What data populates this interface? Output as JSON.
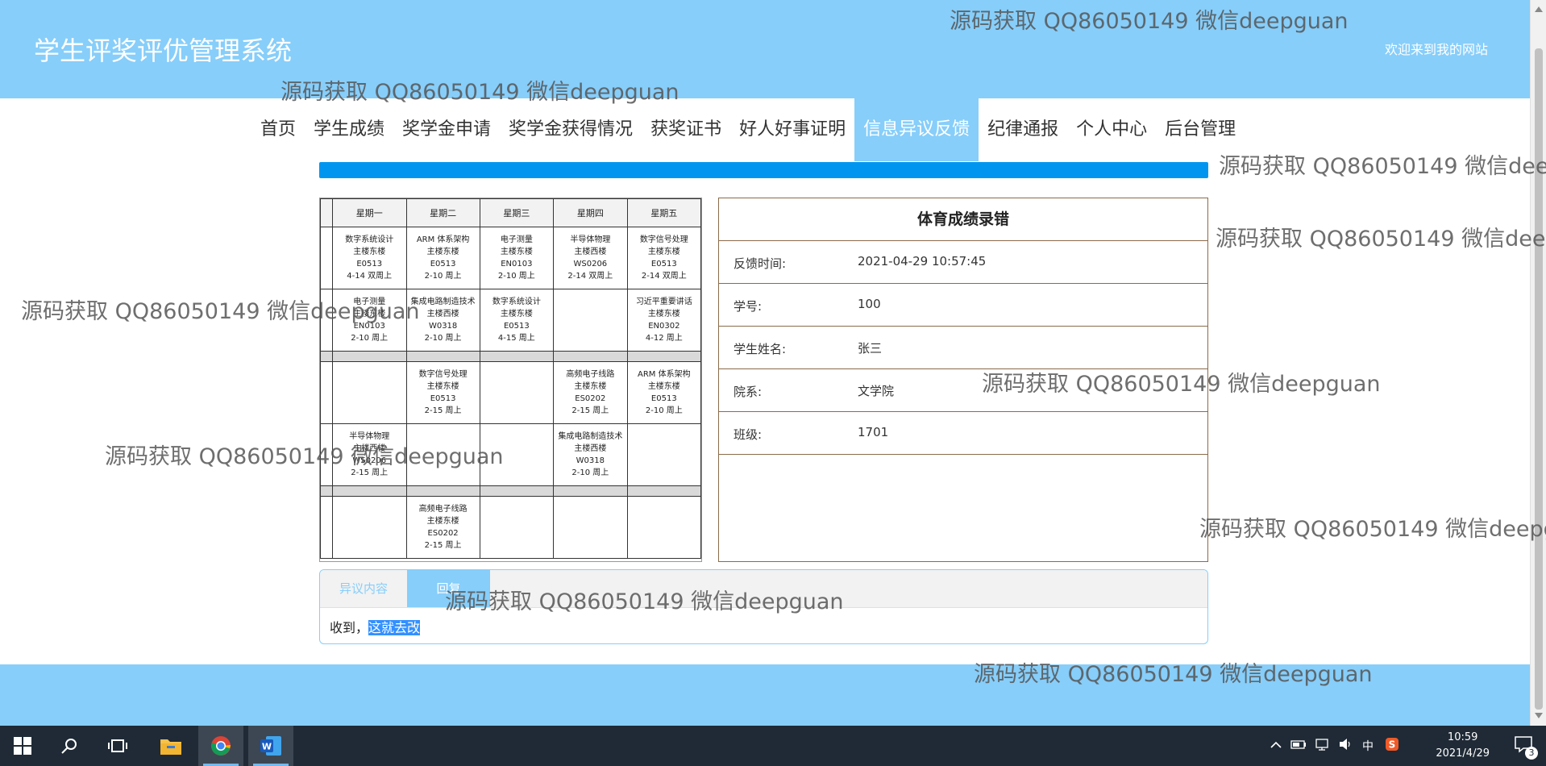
{
  "header": {
    "title": "学生评奖评优管理系统",
    "welcome": "欢迎来到我的网站"
  },
  "nav": {
    "items": [
      "首页",
      "学生成绩",
      "奖学金申请",
      "奖学金获得情况",
      "获奖证书",
      "好人好事证明",
      "信息异议反馈",
      "纪律通报",
      "个人中心",
      "后台管理"
    ],
    "active": "信息异议反馈"
  },
  "schedule": {
    "headers": [
      "",
      "星期一",
      "星期二",
      "星期三",
      "星期四",
      "星期五"
    ],
    "rows": [
      [
        "",
        "数字系统设计\n主楼东楼\nE0513\n4-14 双周上",
        "ARM 体系架构\n主楼东楼\nE0513\n2-10 周上",
        "电子测量\n主楼东楼\nEN0103\n2-10 周上",
        "半导体物理\n主楼西楼\nWS0206\n2-14 双周上",
        "数字信号处理\n主楼东楼\nE0513\n2-14 双周上"
      ],
      [
        "",
        "电子测量\n主楼东楼\nEN0103\n2-10 周上",
        "集成电路制造技术\n主楼西楼\nW0318\n2-10 周上",
        "数字系统设计\n主楼东楼\nE0513\n4-15 周上",
        "",
        "习近平重要讲话\n主楼东楼\nEN0302\n4-12 周上"
      ],
      [
        "",
        "",
        "数字信号处理\n主楼东楼\nE0513\n2-15 周上",
        "",
        "高频电子线路\n主楼东楼\nES0202\n2-15 周上",
        "ARM 体系架构\n主楼东楼\nE0513\n2-10 周上"
      ],
      [
        "",
        "半导体物理\n主楼西楼\nWS0206\n2-15 周上",
        "",
        "",
        "集成电路制造技术\n主楼西楼\nW0318\n2-10 周上",
        ""
      ],
      [
        "",
        "",
        "高频电子线路\n主楼东楼\nES0202\n2-15 周上",
        "",
        "",
        ""
      ]
    ]
  },
  "detail": {
    "title": "体育成绩录错",
    "fields": [
      {
        "label": "反馈时间:",
        "value": "2021-04-29 10:57:45"
      },
      {
        "label": "学号:",
        "value": "100"
      },
      {
        "label": "学生姓名:",
        "value": "张三"
      },
      {
        "label": "院系:",
        "value": "文学院"
      },
      {
        "label": "班级:",
        "value": "1701"
      }
    ]
  },
  "tabs": {
    "items": [
      "异议内容",
      "回复"
    ],
    "active": "回复",
    "reply_prefix": "收到，",
    "reply_selected": "这就去改"
  },
  "watermark": "源码获取 QQ86050149 微信deepguan",
  "taskbar": {
    "icons": [
      "start-icon",
      "search-icon",
      "task-view-icon",
      "file-explorer-icon",
      "chrome-icon",
      "word-icon"
    ],
    "ime": "中",
    "time": "10:59",
    "date": "2021/4/29",
    "notifications": "3"
  }
}
